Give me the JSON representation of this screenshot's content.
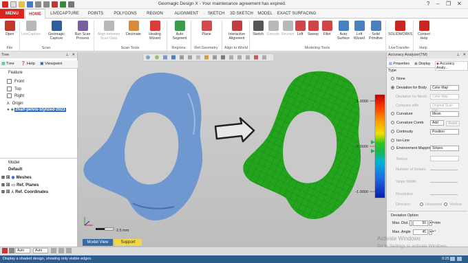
{
  "window": {
    "title": "Geomagic Design X - Your maintenance agreement has expired.",
    "controls": [
      "?",
      "–",
      "❐",
      "✕"
    ]
  },
  "menu": {
    "menu_label": "MENU",
    "tabs": [
      "HOME",
      "LIVECAPTURE",
      "POINTS",
      "POLYGONS",
      "REGION",
      "ALIGNMENT",
      "SKETCH",
      "3D SKETCH",
      "MODEL",
      "EXACT SURFACING"
    ]
  },
  "ribbon": {
    "buttons": [
      {
        "label": "Open",
        "sub": "",
        "color": "#c03a2b",
        "dim": false
      },
      {
        "label": "LiveCapture",
        "sub": "",
        "color": "#b8b8b8",
        "dim": true
      },
      {
        "label": "Geomagic",
        "sub": "Capture",
        "color": "#2f5f9a",
        "dim": false
      },
      {
        "label": "Run Scan",
        "sub": "Process",
        "color": "#7a5fa0",
        "dim": false
      },
      {
        "label": "Align between",
        "sub": "Scan Data",
        "color": "#b8b8b8",
        "dim": true
      },
      {
        "label": "Decimate",
        "sub": "",
        "color": "#d88a3b",
        "dim": false
      },
      {
        "label": "Healing",
        "sub": "Wizard",
        "color": "#d93d3d",
        "dim": false
      },
      {
        "label": "Auto",
        "sub": "Segment",
        "color": "#3b9b4a",
        "dim": false
      },
      {
        "label": "Plane",
        "sub": "",
        "color": "#d24a4a",
        "dim": false
      },
      {
        "label": "Interactive",
        "sub": "Alignment",
        "color": "#c04040",
        "dim": false
      },
      {
        "label": "Sketch",
        "sub": "",
        "color": "#555555",
        "dim": false
      },
      {
        "label": "Extrude",
        "sub": "",
        "color": "#b8b8b8",
        "dim": true
      },
      {
        "label": "Revolve",
        "sub": "",
        "color": "#b8b8b8",
        "dim": true
      },
      {
        "label": "Loft",
        "sub": "",
        "color": "#d04545",
        "dim": false
      },
      {
        "label": "Sweep",
        "sub": "",
        "color": "#d04545",
        "dim": false
      },
      {
        "label": "Fillet",
        "sub": "",
        "color": "#d04545",
        "dim": false
      },
      {
        "label": "Auto",
        "sub": "Surface",
        "color": "#4a7fc0",
        "dim": false
      },
      {
        "label": "Loft",
        "sub": "Wizard",
        "color": "#4a7fc0",
        "dim": false
      },
      {
        "label": "Solid",
        "sub": "Primitive",
        "color": "#4a7fc0",
        "dim": false
      },
      {
        "label": "SOLIDWORKS",
        "sub": "",
        "color": "#c8261f",
        "dim": false
      },
      {
        "label": "Context",
        "sub": "Help",
        "color": "#c8261f",
        "dim": false
      }
    ],
    "groups": [
      "File",
      "Scan",
      "Scan Tools",
      "Regions",
      "Ref.Geometry",
      "Align to World",
      "Modeling Tools",
      "LiveTransfer",
      "Help"
    ]
  },
  "tree_panel": {
    "header": "Tree",
    "tabs": [
      "Tree",
      "Help",
      "Viewpoint"
    ],
    "feature_label": "Feature",
    "features": [
      "Front",
      "Top",
      "Right",
      "Origin",
      "2half-pelvis-stylized-2023"
    ],
    "model_label": "Model",
    "model_root": "Default",
    "model_items": [
      "Meshes",
      "Ref. Planes",
      "Ref. Coordinates"
    ]
  },
  "viewport": {
    "scale_label": "2.5 mm",
    "bottom_tabs": [
      "Model View",
      "Support"
    ],
    "color_scale_labels": [
      "1.0000",
      "0.0000",
      "-1.0000"
    ],
    "colors": {
      "mesh_blue": "#6f98d0",
      "mesh_green": "#22a51c",
      "background": "#c9c9c9"
    }
  },
  "right_panel": {
    "header": "Accuracy Analyzer(TM)",
    "tabs": [
      "Properties",
      "Display",
      "Accuracy Analy..."
    ],
    "type_label": "Type",
    "options": [
      {
        "label": "None",
        "selected": false,
        "dim": false,
        "value": ""
      },
      {
        "label": "Deviation for Body",
        "selected": true,
        "dim": false,
        "value": "Color Map"
      },
      {
        "label": "Deviation for Mesh",
        "selected": false,
        "dim": true,
        "value": "Color Map"
      },
      {
        "label": "Compare with",
        "selected": false,
        "dim": true,
        "value": "Original Scan Dat"
      },
      {
        "label": "Curvature",
        "selected": false,
        "dim": false,
        "value": "Mean"
      },
      {
        "label": "Curvature Comb",
        "selected": false,
        "dim": false,
        "value": "Add"
      },
      {
        "label": "Continuity",
        "selected": false,
        "dim": false,
        "value": "Position"
      },
      {
        "label": "Iso-Line",
        "selected": false,
        "dim": false,
        "value": ""
      },
      {
        "label": "Environment Mapping",
        "selected": false,
        "dim": false,
        "value": "Stripes"
      }
    ],
    "reset_label": "Reset",
    "env_sub": [
      "Texture",
      "Number of Stripes",
      "Stripe Width",
      "Resolution",
      "Direction"
    ],
    "direction_options": [
      "Horizontal",
      "Vertical"
    ],
    "deviation_option_label": "Deviation Option",
    "max_dist_label": "Max. Dist.",
    "max_dist_value": "50",
    "max_dist_unit": "mm",
    "max_angle_label": "Max. Angle",
    "max_angle_value": "45",
    "max_angle_unit": "°"
  },
  "bottom_bar": {
    "left_selects": [
      "Auto",
      "Auto"
    ],
    "watermark_1": "Activate Windows",
    "watermark_2": "Go to Settings to activate Windows.",
    "time": "0:25"
  },
  "status": {
    "text": "Display a shaded design, showing only visible edges."
  }
}
